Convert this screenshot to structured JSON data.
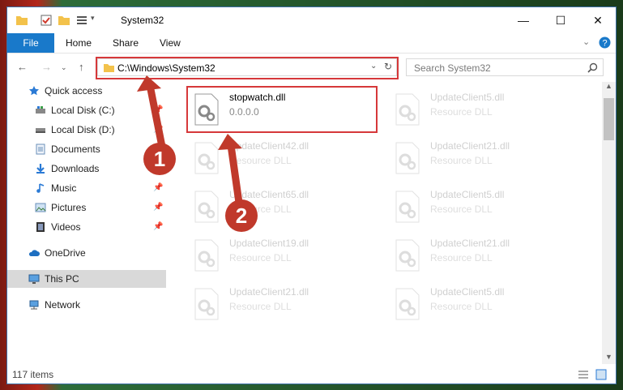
{
  "window": {
    "title": "System32"
  },
  "ribbon": {
    "file": "File",
    "home": "Home",
    "share": "Share",
    "view": "View"
  },
  "address": {
    "path": "C:\\Windows\\System32",
    "search_placeholder": "Search System32"
  },
  "sidebar": {
    "items": [
      {
        "label": "Quick access"
      },
      {
        "label": "Local Disk (C:)"
      },
      {
        "label": "Local Disk (D:)"
      },
      {
        "label": "Documents"
      },
      {
        "label": "Downloads"
      },
      {
        "label": "Music"
      },
      {
        "label": "Pictures"
      },
      {
        "label": "Videos"
      },
      {
        "label": "OneDrive"
      },
      {
        "label": "This PC"
      },
      {
        "label": "Network"
      }
    ]
  },
  "files": [
    {
      "name": "stopwatch.dll",
      "sub": "0.0.0.0"
    },
    {
      "name": "UpdateClient5.dll",
      "sub": "Resource DLL"
    },
    {
      "name": "UpdateClient42.dll",
      "sub": "Resource DLL"
    },
    {
      "name": "UpdateClient21.dll",
      "sub": "Resource DLL"
    },
    {
      "name": "UpdateClient65.dll",
      "sub": "Resource DLL"
    },
    {
      "name": "UpdateClient5.dll",
      "sub": "Resource DLL"
    },
    {
      "name": "UpdateClient19.dll",
      "sub": "Resource DLL"
    },
    {
      "name": "UpdateClient21.dll",
      "sub": "Resource DLL"
    },
    {
      "name": "UpdateClient21.dll",
      "sub": "Resource DLL"
    },
    {
      "name": "UpdateClient5.dll",
      "sub": "Resource DLL"
    }
  ],
  "status": {
    "items": "117 items"
  },
  "annotations": {
    "step1": "1",
    "step2": "2"
  },
  "colors": {
    "accent": "#1979ca",
    "highlight": "#d6383a",
    "badge": "#c0392b"
  }
}
